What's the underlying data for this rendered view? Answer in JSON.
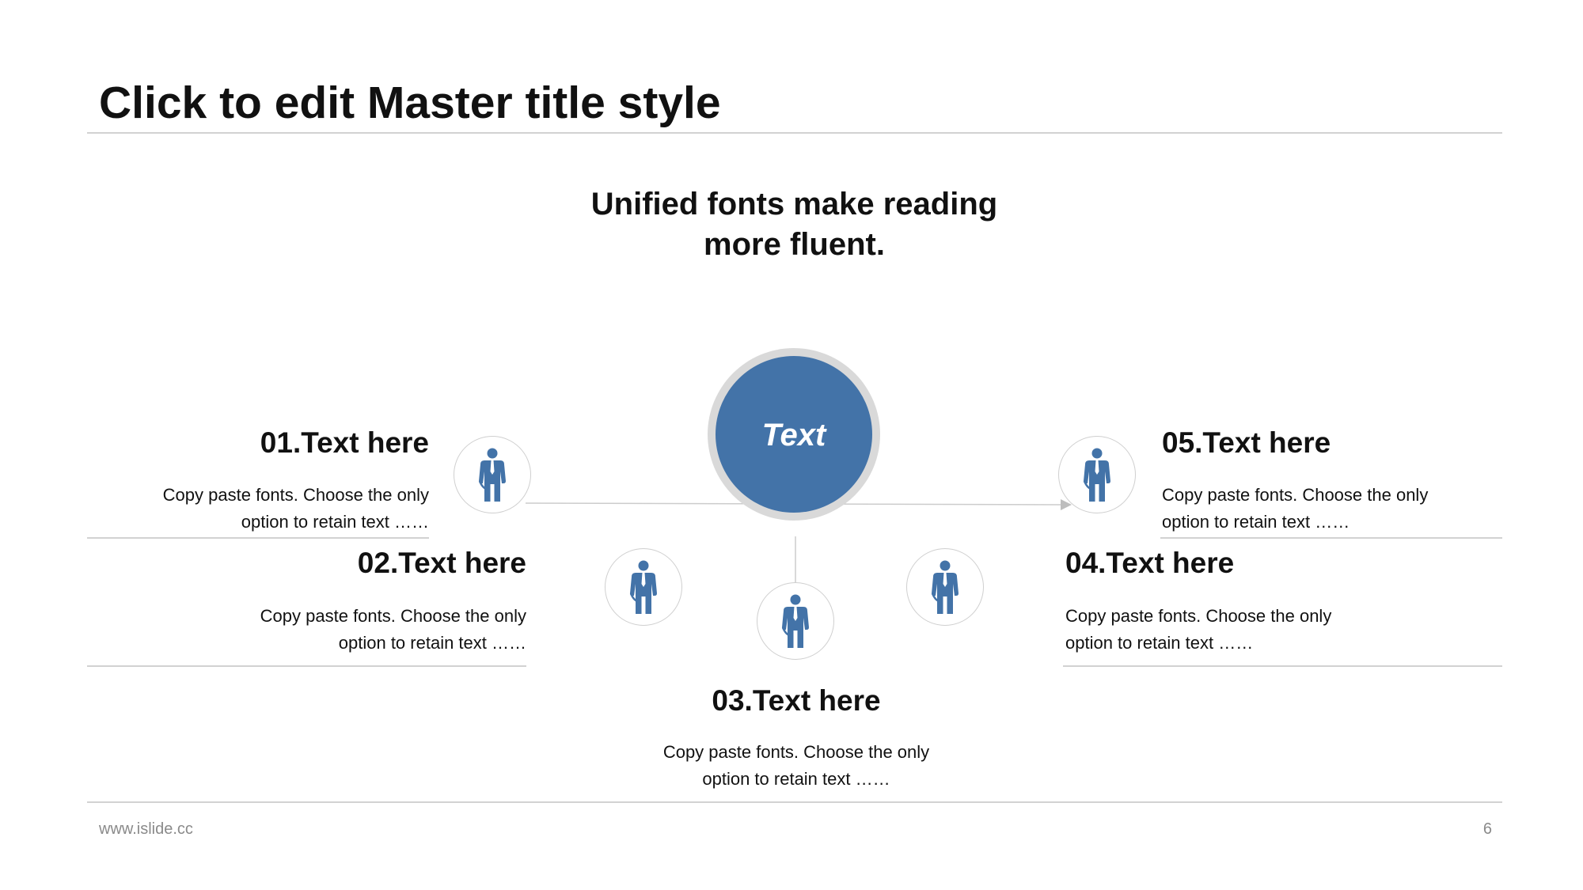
{
  "slide": {
    "title": "Click to edit Master title style",
    "subtitle": "Unified fonts make reading more fluent.",
    "center_label": "Text"
  },
  "items": [
    {
      "title": "01.Text here",
      "desc": "Copy paste fonts. Choose the only option to retain text ……"
    },
    {
      "title": "02.Text here",
      "desc": "Copy paste fonts. Choose the only option to retain text ……"
    },
    {
      "title": "03.Text here",
      "desc": "Copy paste fonts. Choose the only option to retain text ……"
    },
    {
      "title": "04.Text here",
      "desc": "Copy paste fonts. Choose the only option to retain text ……"
    },
    {
      "title": "05.Text here",
      "desc": "Copy paste fonts. Choose the only option to retain text ……"
    }
  ],
  "icons": {
    "person": "businessman-icon"
  },
  "colors": {
    "accent": "#4373a8",
    "divider": "#d2d2d2",
    "ring": "#d9d9d9",
    "footer": "#8a8a8a"
  },
  "footer": {
    "url": "www.islide.cc",
    "page_number": "6"
  }
}
